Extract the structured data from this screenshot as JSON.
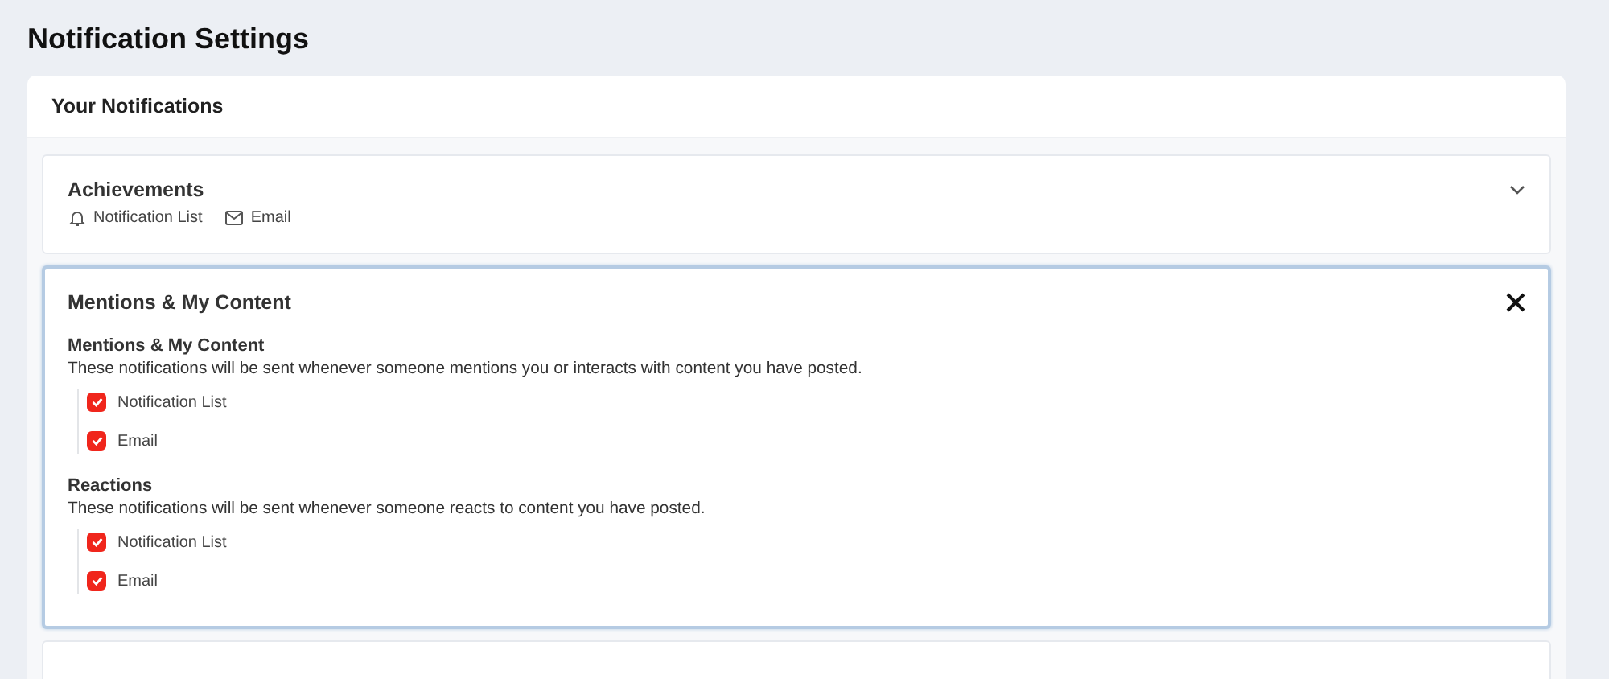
{
  "page_title": "Notification Settings",
  "card": {
    "title": "Your Notifications",
    "sections": [
      {
        "title": "Achievements",
        "expanded": false,
        "channels": [
          {
            "kind": "bell",
            "label": "Notification List"
          },
          {
            "kind": "mail",
            "label": "Email"
          }
        ]
      },
      {
        "title": "Mentions & My Content",
        "expanded": true,
        "groups": [
          {
            "title": "Mentions & My Content",
            "description": "These notifications will be sent whenever someone mentions you or interacts with content you have posted.",
            "options": [
              {
                "label": "Notification List",
                "checked": true
              },
              {
                "label": "Email",
                "checked": true
              }
            ]
          },
          {
            "title": "Reactions",
            "description": "These notifications will be sent whenever someone reacts to content you have posted.",
            "options": [
              {
                "label": "Notification List",
                "checked": true
              },
              {
                "label": "Email",
                "checked": true
              }
            ]
          }
        ]
      }
    ]
  }
}
